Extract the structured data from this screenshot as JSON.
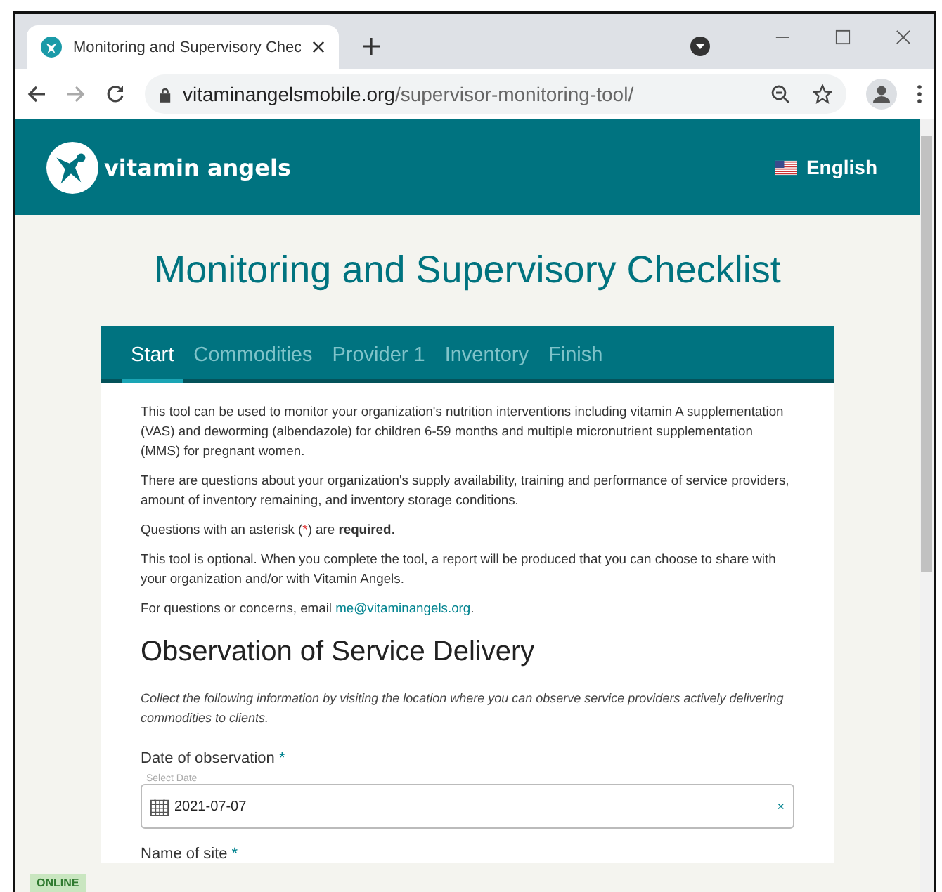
{
  "browser": {
    "tab_title": "Monitoring and Supervisory Chec",
    "url_host": "vitaminangelsmobile.org",
    "url_path": "/supervisor-monitoring-tool/"
  },
  "header": {
    "logo_text": "vitamin angels",
    "language": "English"
  },
  "page_title": "Monitoring and Supervisory Checklist",
  "tabs": [
    {
      "label": "Start",
      "selected": true
    },
    {
      "label": "Commodities",
      "selected": false
    },
    {
      "label": "Provider 1",
      "selected": false
    },
    {
      "label": "Inventory",
      "selected": false
    },
    {
      "label": "Finish",
      "selected": false
    }
  ],
  "intro": [
    {
      "parts": [
        {
          "kind": "text",
          "text": "This tool can be used to monitor your organization's nutrition interventions including vitamin A supplementation (VAS) and deworming (albendazole) for children 6-59 months and multiple micronutrient supplementation (MMS) for pregnant women."
        }
      ]
    },
    {
      "parts": [
        {
          "kind": "text",
          "text": "There are questions about your organization's supply availability, training and performance of service providers, amount of inventory remaining, and inventory storage conditions."
        }
      ]
    },
    {
      "parts": [
        {
          "kind": "text",
          "text": "Questions with an asterisk ("
        },
        {
          "kind": "mark",
          "text": "*"
        },
        {
          "kind": "text",
          "text": ") are **required**."
        }
      ]
    },
    {
      "parts": [
        {
          "kind": "text",
          "text": "This tool is optional. When you complete the tool, a report will be produced that you can choose to share with your organization and/or with Vitamin Angels."
        }
      ]
    },
    {
      "parts": [
        {
          "kind": "text",
          "text": "For questions or concerns, email "
        },
        {
          "kind": "link",
          "text": "me@vitaminangels.org"
        },
        {
          "kind": "text",
          "text": "."
        }
      ]
    }
  ],
  "section": {
    "title": "Observation of Service Delivery",
    "description": "Collect the following information by visiting the location where you can observe service providers actively delivering commodities to clients.",
    "fields": [
      {
        "kind": "date",
        "label": "Date of observation",
        "required": true,
        "placeholder": "Select Date",
        "value": "2021-07-07",
        "clear": "×"
      },
      {
        "kind": "label",
        "label": "Name of site",
        "required": true
      }
    ]
  },
  "status": "ONLINE"
}
